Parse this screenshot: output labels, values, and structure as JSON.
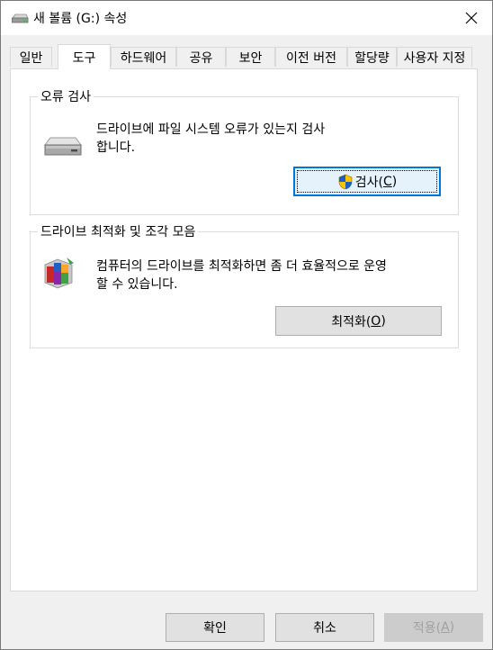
{
  "window": {
    "title": "새 볼륨 (G:) 속성",
    "close_symbol": "✕"
  },
  "tabs": [
    {
      "label": "일반"
    },
    {
      "label": "도구"
    },
    {
      "label": "하드웨어"
    },
    {
      "label": "공유"
    },
    {
      "label": "보안"
    },
    {
      "label": "이전 버전"
    },
    {
      "label": "할당량"
    },
    {
      "label": "사용자 지정"
    }
  ],
  "active_tab": "도구",
  "error_check": {
    "title": "오류 검사",
    "desc_line1": "드라이브에 파일 시스템 오류가 있는지 검사",
    "desc_line2": "합니다.",
    "button_label": "검사(",
    "button_key": "C",
    "button_close": ")",
    "icon": "drive-icon",
    "button_icon": "uac-shield-icon"
  },
  "optimize": {
    "title": "드라이브 최적화 및 조각 모음",
    "desc_line1": "컴퓨터의 드라이브를 최적화하면 좀 더 효율적으로 운영",
    "desc_line2": "할 수 있습니다.",
    "button_label": "최적화(",
    "button_key": "O",
    "button_close": ")",
    "icon": "defrag-icon"
  },
  "footer": {
    "ok_label": "확인",
    "cancel_label": "취소",
    "apply_label": "적용(",
    "apply_key": "A",
    "apply_close": ")"
  },
  "colors": {
    "focus_border": "#0078d7",
    "button_bg": "#e1e1e1",
    "disabled_text": "#a0a0a0"
  }
}
